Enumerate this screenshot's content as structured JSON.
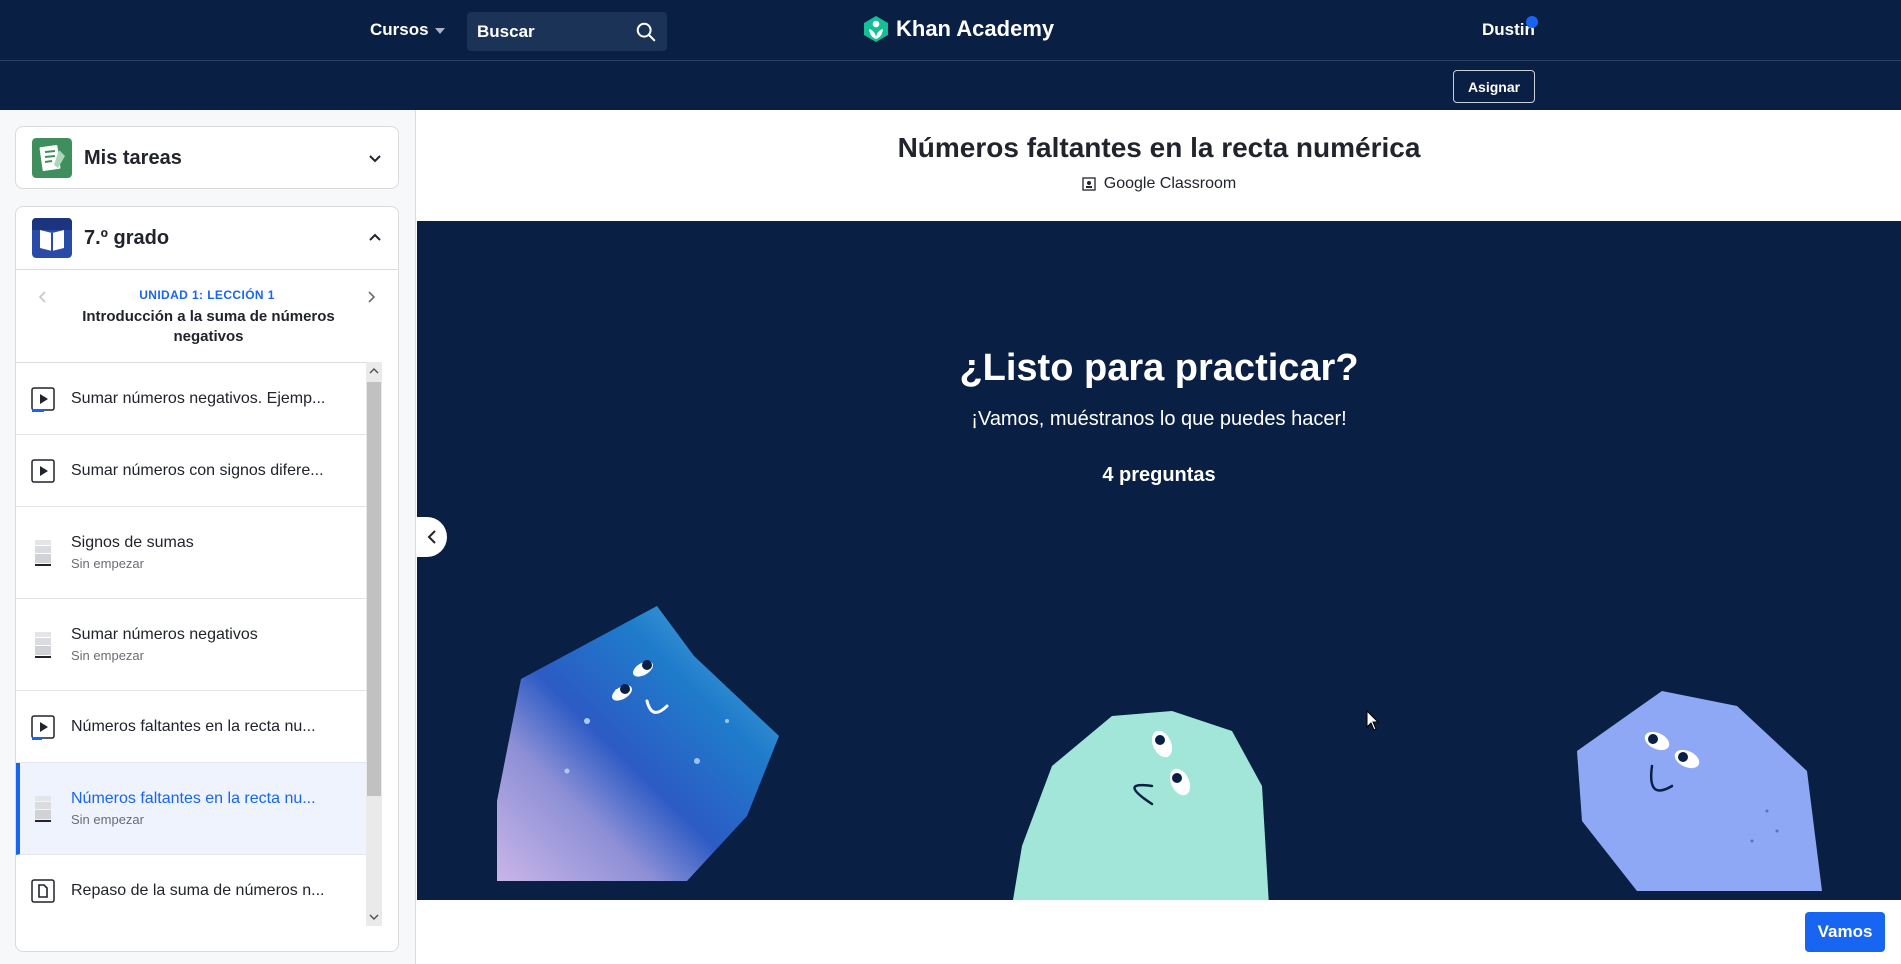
{
  "topnav": {
    "courses_label": "Cursos",
    "search_placeholder": "Buscar",
    "logo_text": "Khan Academy",
    "user_name": "Dustin"
  },
  "subnav": {
    "assign_label": "Asignar"
  },
  "sidebar": {
    "my_tasks": "Mis tareas",
    "grade": "7.º grado",
    "lesson_kicker": "UNIDAD 1: LECCIÓN 1",
    "lesson_title": "Introducción a la suma de números negativos",
    "items": [
      {
        "title": "Sumar números negativos. Ejemp...",
        "type": "video",
        "status": ""
      },
      {
        "title": "Sumar números con signos difere...",
        "type": "video",
        "status": ""
      },
      {
        "title": "Signos de sumas",
        "type": "exercise",
        "status": "Sin empezar"
      },
      {
        "title": "Sumar números negativos",
        "type": "exercise",
        "status": "Sin empezar"
      },
      {
        "title": "Números faltantes en la recta nu...",
        "type": "video",
        "status": ""
      },
      {
        "title": "Números faltantes en la recta nu...",
        "type": "exercise",
        "status": "Sin empezar",
        "active": true
      },
      {
        "title": "Repaso de la suma de números n...",
        "type": "article",
        "status": ""
      }
    ]
  },
  "main": {
    "title": "Números faltantes en la recta numérica",
    "classroom_label": "Google Classroom",
    "hero_title": "¿Listo para practicar?",
    "hero_subtitle": "¡Vamos, muéstranos lo que puedes hacer!",
    "question_count": "4 preguntas",
    "go_label": "Vamos"
  },
  "colors": {
    "navy": "#0a1f44",
    "accent": "#1865f2",
    "teal_blob": "#a2e6da",
    "blue_blob": "#8fa8f5"
  }
}
